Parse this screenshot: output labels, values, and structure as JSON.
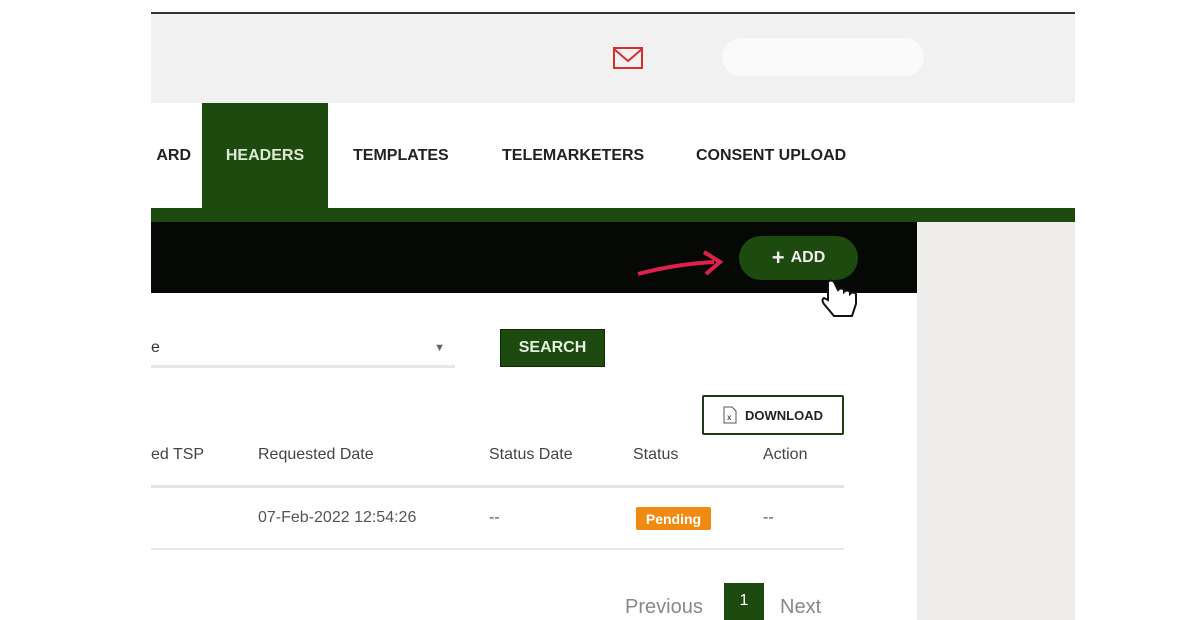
{
  "header": {
    "mail_icon": "mail-icon",
    "accent": "#1d4a0e"
  },
  "nav": {
    "tabs": [
      {
        "label": "ARD"
      },
      {
        "label": "HEADERS",
        "active": true
      },
      {
        "label": "TEMPLATES"
      },
      {
        "label": "TELEMARKETERS"
      },
      {
        "label": "CONSENT UPLOAD"
      }
    ]
  },
  "toolbar": {
    "add_label": "ADD",
    "add_icon": "plus-icon"
  },
  "filter": {
    "select_value": "e",
    "search_label": "SEARCH"
  },
  "download": {
    "label": "DOWNLOAD",
    "icon": "excel-file-icon"
  },
  "table": {
    "columns": [
      "ed TSP",
      "Requested Date",
      "Status Date",
      "Status",
      "Action"
    ],
    "rows": [
      {
        "requested_date": "07-Feb-2022 12:54:26",
        "status_date": "--",
        "status": "Pending",
        "action": "--"
      }
    ]
  },
  "status_colors": {
    "Pending": "#f08a12"
  },
  "pagination": {
    "previous": "Previous",
    "current": "1",
    "next": "Next"
  }
}
